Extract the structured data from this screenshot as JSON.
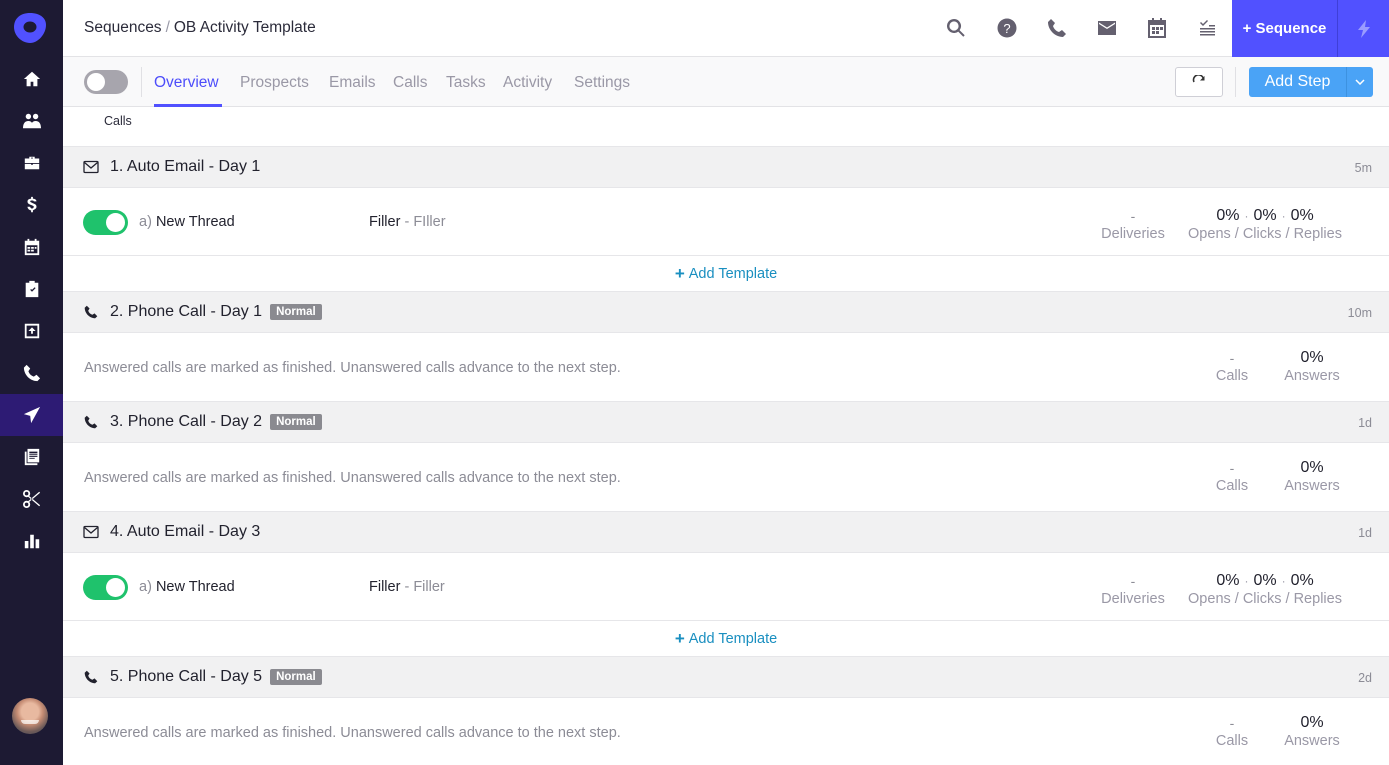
{
  "header": {
    "breadcrumb_root": "Sequences",
    "breadcrumb_sep": "/",
    "breadcrumb_current": "OB Activity Template",
    "icons": [
      "search-icon",
      "help-icon",
      "phone-icon",
      "mail-icon",
      "calendar-icon",
      "tasks-icon"
    ],
    "new_sequence_label": "+ Sequence",
    "bolt_icon": "bolt-icon"
  },
  "sidebar": {
    "items": [
      {
        "name": "home",
        "icon": "home-icon",
        "active": false
      },
      {
        "name": "prospects",
        "icon": "people-icon",
        "active": false
      },
      {
        "name": "accounts",
        "icon": "briefcase-icon",
        "active": false
      },
      {
        "name": "opportunities",
        "icon": "dollar-icon",
        "active": false
      },
      {
        "name": "meetings",
        "icon": "calendar-icon",
        "active": false
      },
      {
        "name": "tasks",
        "icon": "clipboard-icon",
        "active": false
      },
      {
        "name": "inbox",
        "icon": "inbox-upload-icon",
        "active": false
      },
      {
        "name": "calls",
        "icon": "phone-icon",
        "active": false
      },
      {
        "name": "sequences",
        "icon": "paper-plane-icon",
        "active": true
      },
      {
        "name": "templates",
        "icon": "documents-icon",
        "active": false
      },
      {
        "name": "snippets",
        "icon": "scissors-icon",
        "active": false
      },
      {
        "name": "reports",
        "icon": "bar-chart-icon",
        "active": false
      }
    ]
  },
  "tabs": {
    "items": [
      "Overview",
      "Prospects",
      "Emails",
      "Calls",
      "Tasks",
      "Activity",
      "Settings"
    ],
    "active": "Overview",
    "sequence_enabled": false,
    "add_step_label": "Add Step"
  },
  "sub_label": "Calls",
  "steps": [
    {
      "type": "email",
      "title": "1. Auto Email - Day 1",
      "delay": "5m",
      "thread_prefix": "a)",
      "thread_label": "New Thread",
      "enabled": true,
      "template_name": "Filler",
      "template_dash": " - ",
      "template_sub": "FIller",
      "deliveries": "-",
      "deliveries_label": "Deliveries",
      "opens": "0%",
      "clicks": "0%",
      "replies": "0%",
      "rates_label": "Opens / Clicks / Replies",
      "add_template_label": "Add Template"
    },
    {
      "type": "call",
      "title": "2. Phone Call - Day 1",
      "priority": "Normal",
      "delay": "10m",
      "description": "Answered calls are marked as finished. Unanswered calls advance to the next step.",
      "calls": "-",
      "calls_label": "Calls",
      "answers": "0%",
      "answers_label": "Answers"
    },
    {
      "type": "call",
      "title": "3. Phone Call - Day 2",
      "priority": "Normal",
      "delay": "1d",
      "description": "Answered calls are marked as finished. Unanswered calls advance to the next step.",
      "calls": "-",
      "calls_label": "Calls",
      "answers": "0%",
      "answers_label": "Answers"
    },
    {
      "type": "email",
      "title": "4. Auto Email - Day 3",
      "delay": "1d",
      "thread_prefix": "a)",
      "thread_label": "New Thread",
      "enabled": true,
      "template_name": "Filler",
      "template_dash": " - ",
      "template_sub": "Filler",
      "deliveries": "-",
      "deliveries_label": "Deliveries",
      "opens": "0%",
      "clicks": "0%",
      "replies": "0%",
      "rates_label": "Opens / Clicks / Replies",
      "add_template_label": "Add Template"
    },
    {
      "type": "call",
      "title": "5. Phone Call - Day 5",
      "priority": "Normal",
      "delay": "2d",
      "description": "Answered calls are marked as finished. Unanswered calls advance to the next step.",
      "calls": "-",
      "calls_label": "Calls",
      "answers": "0%",
      "answers_label": "Answers"
    }
  ],
  "colors": {
    "sidebar_bg": "#1d1a33",
    "sidebar_active": "#2d1b74",
    "brand": "#5151ff",
    "add_step": "#4aa3f6",
    "toggle_on": "#1fc26c",
    "link": "#1a8fc0"
  }
}
